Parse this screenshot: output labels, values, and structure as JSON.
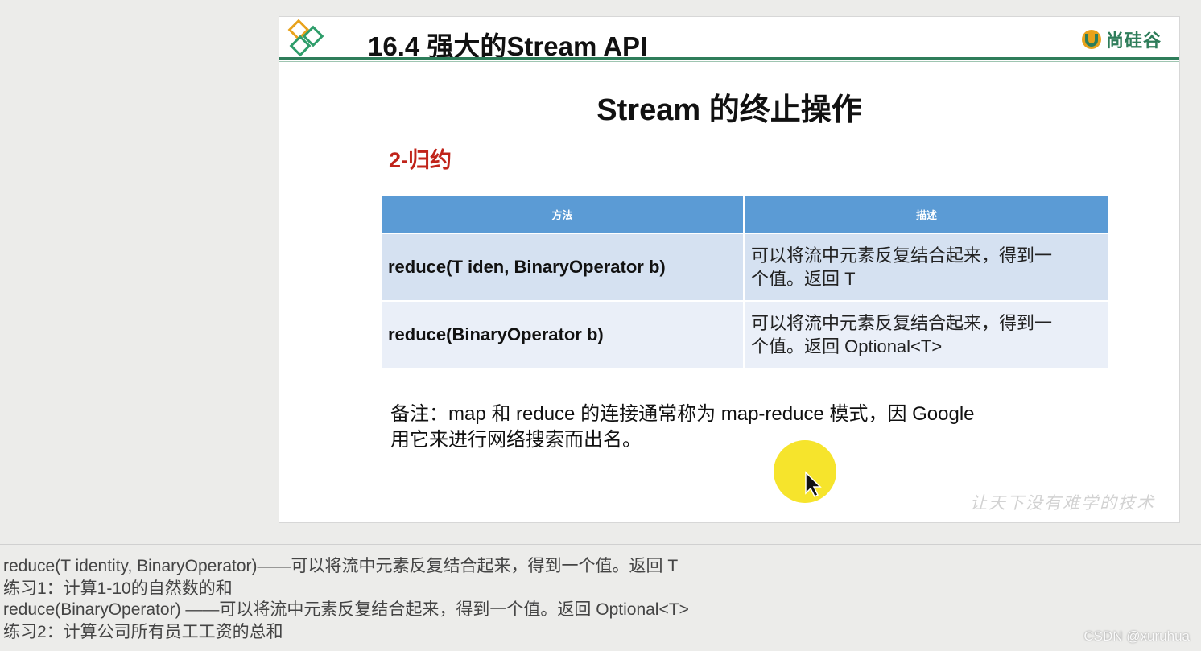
{
  "slide": {
    "title": "16.4 强大的Stream API",
    "brand": "尚硅谷",
    "section_title": "Stream 的终止操作",
    "subheading": "2-归约",
    "table": {
      "headers": [
        "方法",
        "描述"
      ],
      "rows": [
        {
          "method": "reduce(T iden, BinaryOperator b)",
          "desc_line1": "可以将流中元素反复结合起来，得到一",
          "desc_line2": "个值。返回 T"
        },
        {
          "method": "reduce(BinaryOperator b)",
          "desc_line1": "可以将流中元素反复结合起来，得到一",
          "desc_line2": "个值。返回 Optional<T>"
        }
      ]
    },
    "note_line1": "备注：map 和 reduce 的连接通常称为 map-reduce 模式，因 Google",
    "note_line2": "用它来进行网络搜索而出名。",
    "slogan": "让天下没有难学的技术"
  },
  "caption": {
    "lines": [
      "reduce(T identity, BinaryOperator)——可以将流中元素反复结合起来，得到一个值。返回 T",
      "练习1：计算1-10的自然数的和",
      "reduce(BinaryOperator) ——可以将流中元素反复结合起来，得到一个值。返回 Optional<T>",
      "练习2：计算公司所有员工工资的总和"
    ]
  },
  "watermark": "CSDN @xuruhua",
  "colors": {
    "accent_green": "#2e7d5a",
    "table_header": "#5b9bd5",
    "subheading_red": "#c0241a",
    "cursor_highlight": "#f5e21a"
  },
  "icons": [
    "diamond-logo-icon",
    "brand-logo-icon",
    "mouse-pointer-icon"
  ]
}
